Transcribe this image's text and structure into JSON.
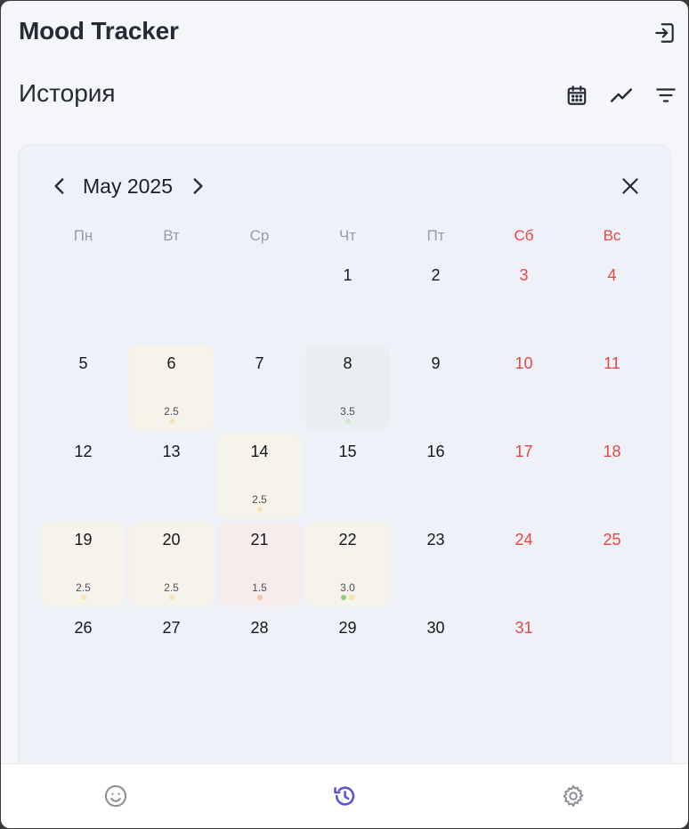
{
  "app": {
    "title": "Mood Tracker"
  },
  "page": {
    "title": "История"
  },
  "icons": {
    "logout": "logout-icon",
    "calendar": "calendar-icon",
    "chart": "trend-chart-icon",
    "filter": "filter-icon"
  },
  "calendar": {
    "month_label": "May 2025",
    "weekdays": [
      {
        "label": "Пн",
        "weekend": false
      },
      {
        "label": "Вт",
        "weekend": false
      },
      {
        "label": "Ср",
        "weekend": false
      },
      {
        "label": "Чт",
        "weekend": false
      },
      {
        "label": "Пт",
        "weekend": false
      },
      {
        "label": "Сб",
        "weekend": true
      },
      {
        "label": "Вс",
        "weekend": true
      }
    ],
    "leading_blanks": 3,
    "days": [
      {
        "day": "1"
      },
      {
        "day": "2"
      },
      {
        "day": "3",
        "weekend": true
      },
      {
        "day": "4",
        "weekend": true
      },
      {
        "day": "5"
      },
      {
        "day": "6",
        "score": "2.5",
        "bg": "#f6f3ea",
        "dots": [
          "#f7e3b0"
        ]
      },
      {
        "day": "7"
      },
      {
        "day": "8",
        "score": "3.5",
        "bg": "#e9eff0",
        "dots": [
          "#cfe6cf"
        ]
      },
      {
        "day": "9"
      },
      {
        "day": "10",
        "weekend": true
      },
      {
        "day": "11",
        "weekend": true
      },
      {
        "day": "12"
      },
      {
        "day": "13"
      },
      {
        "day": "14",
        "score": "2.5",
        "bg": "#f6f3ea",
        "dots": [
          "#f7e3b0"
        ]
      },
      {
        "day": "15"
      },
      {
        "day": "16"
      },
      {
        "day": "17",
        "weekend": true
      },
      {
        "day": "18",
        "weekend": true
      },
      {
        "day": "19",
        "score": "2.5",
        "bg": "#f6f3ea",
        "dots": [
          "#f7e3b0"
        ]
      },
      {
        "day": "20",
        "score": "2.5",
        "bg": "#f6f3ea",
        "dots": [
          "#f7e3b0"
        ]
      },
      {
        "day": "21",
        "score": "1.5",
        "bg": "#f6ecec",
        "dots": [
          "#f4c4a8"
        ]
      },
      {
        "day": "22",
        "score": "3.0",
        "bg": "#f6f3ea",
        "dots": [
          "#8ccc7a",
          "#f7e3b0"
        ]
      },
      {
        "day": "23"
      },
      {
        "day": "24",
        "weekend": true
      },
      {
        "day": "25",
        "weekend": true
      },
      {
        "day": "26"
      },
      {
        "day": "27"
      },
      {
        "day": "28"
      },
      {
        "day": "29"
      },
      {
        "day": "30"
      },
      {
        "day": "31",
        "weekend": true
      }
    ]
  },
  "nav": {
    "tabs": [
      {
        "name": "mood",
        "icon": "smiley-icon",
        "active": false
      },
      {
        "name": "history",
        "icon": "history-icon",
        "active": true
      },
      {
        "name": "settings",
        "icon": "gear-icon",
        "active": false
      }
    ],
    "active_color": "#5b54d6",
    "inactive_color": "#8d8f96"
  },
  "colors": {
    "weekend": "#e8473e",
    "text": "#262a35",
    "background": "#f4f6fa",
    "card": "#eff1f8"
  }
}
